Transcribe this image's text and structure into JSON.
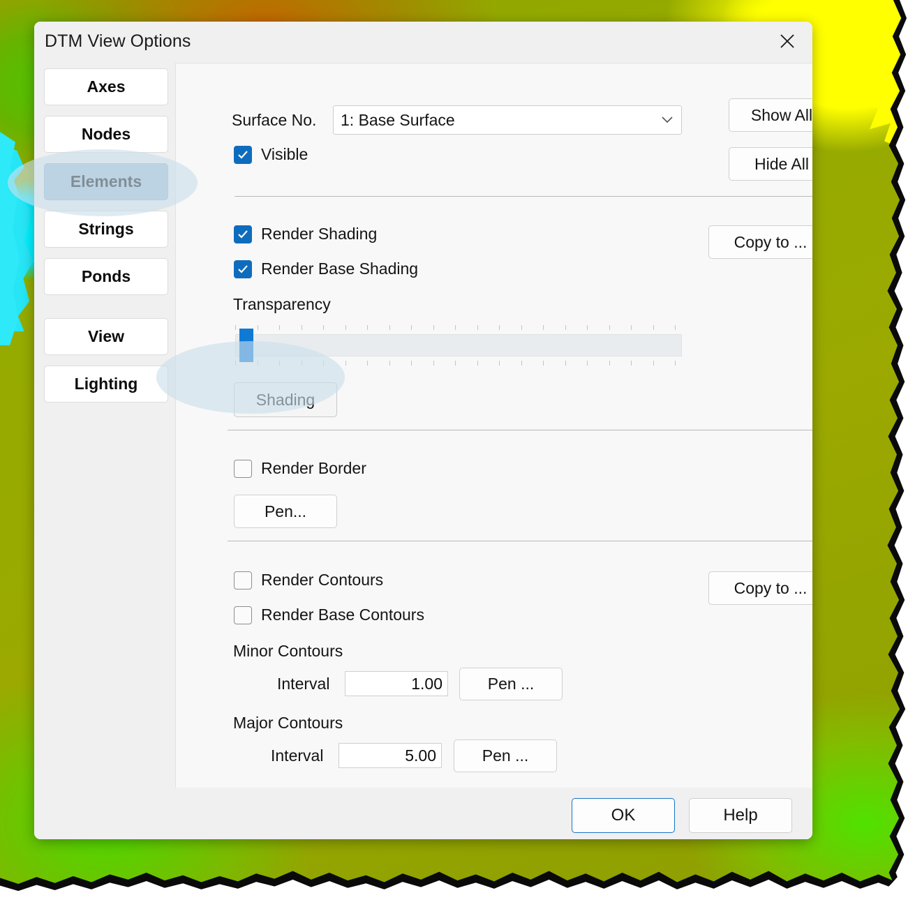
{
  "window": {
    "title": "DTM View Options",
    "close_icon": "close-icon"
  },
  "sidebar": {
    "items": [
      {
        "label": "Axes",
        "active": false
      },
      {
        "label": "Nodes",
        "active": false
      },
      {
        "label": "Elements",
        "active": true
      },
      {
        "label": "Strings",
        "active": false
      },
      {
        "label": "Ponds",
        "active": false
      },
      {
        "label": "View",
        "active": false
      },
      {
        "label": "Lighting",
        "active": false
      }
    ]
  },
  "panel": {
    "surface_label": "Surface No.",
    "surface_value": "1: Base Surface",
    "surface_dropdown_icon": "chevron-down-icon",
    "show_all_label": "Show All",
    "hide_all_label": "Hide All",
    "visible_label": "Visible",
    "visible_checked": true,
    "render_shading_label": "Render Shading",
    "render_shading_checked": true,
    "render_base_shading_label": "Render Base Shading",
    "render_base_shading_checked": true,
    "copy_to_shading_label": "Copy to ...",
    "transparency_label": "Transparency",
    "transparency_value": 0,
    "shading_button_label": "Shading",
    "render_border_label": "Render Border",
    "render_border_checked": false,
    "border_pen_label": "Pen...",
    "render_contours_label": "Render Contours",
    "render_contours_checked": false,
    "render_base_contours_label": "Render Base Contours",
    "render_base_contours_checked": false,
    "copy_to_contours_label": "Copy to ...",
    "minor_contours_label": "Minor Contours",
    "minor_interval_label": "Interval",
    "minor_interval_value": "1.00",
    "minor_pen_label": "Pen ...",
    "major_contours_label": "Major Contours",
    "major_interval_label": "Interval",
    "major_interval_value": "5.00",
    "major_pen_label": "Pen ..."
  },
  "footer": {
    "ok_label": "OK",
    "help_label": "Help"
  },
  "colors": {
    "accent": "#0f6cbd",
    "slider_thumb": "#0f7ad4",
    "active_tab": "#a7c0d6",
    "highlight": "#cadeeb",
    "focus_border": "#1673c7"
  }
}
